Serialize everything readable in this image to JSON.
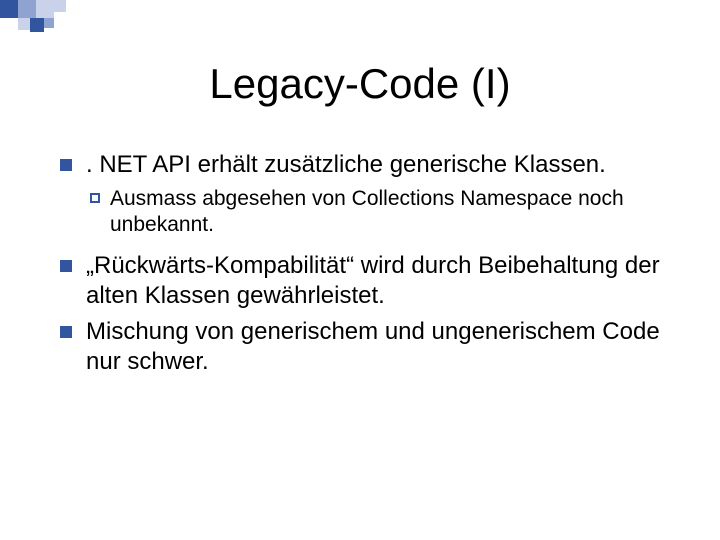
{
  "title": "Legacy-Code (I)",
  "bullets": {
    "b1": ". NET API erhält zusätzliche generische Klassen.",
    "b1_sub": "Ausmass abgesehen von Collections Namespace noch unbekannt.",
    "b2": "„Rückwärts-Kompabilität“ wird durch Beibehaltung der alten Klassen gewährleistet.",
    "b3": "Mischung von generischem und ungenerischem Code nur schwer."
  }
}
